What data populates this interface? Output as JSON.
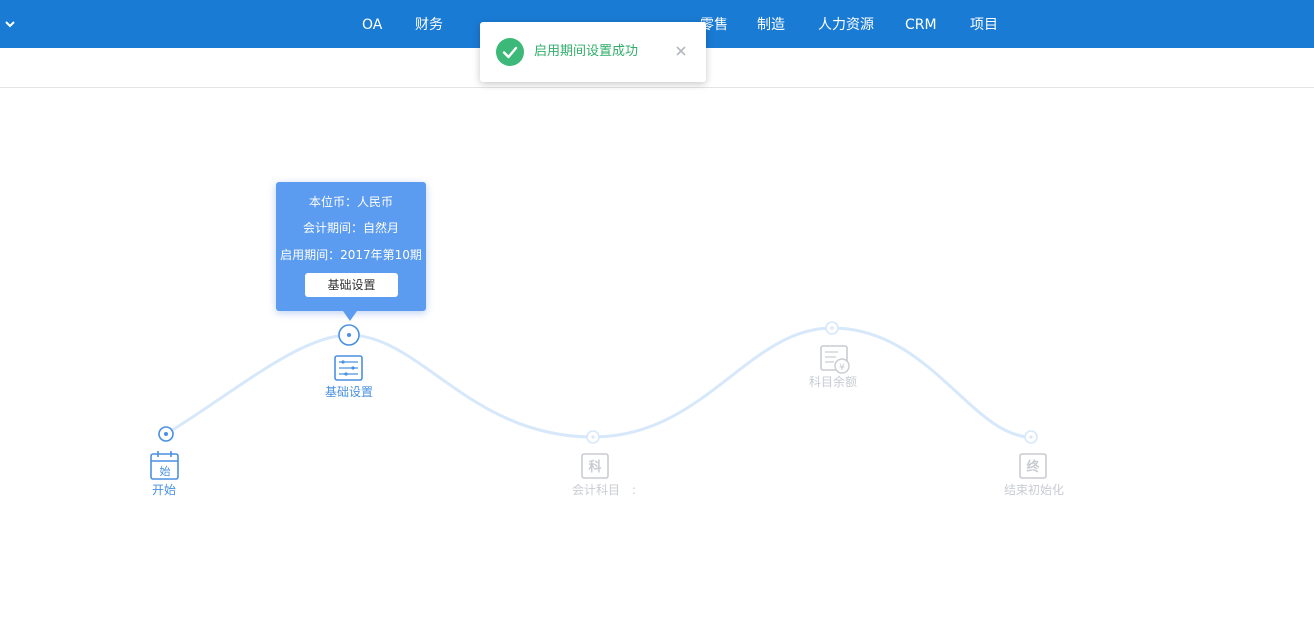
{
  "top_nav": {
    "items": [
      {
        "label": "OA"
      },
      {
        "label": "财务"
      },
      {
        "label": "零售"
      },
      {
        "label": "制造"
      },
      {
        "label": "人力资源"
      },
      {
        "label": "CRM"
      },
      {
        "label": "项目"
      }
    ]
  },
  "toast": {
    "message": "启用期间设置成功",
    "status_color": "#2fae6a"
  },
  "popover": {
    "currency_line": "本位币：人民币",
    "period_line": "会计期间：自然月",
    "start_period_line": "启用期间：2017年第10期",
    "button_label": "基础设置"
  },
  "steps": [
    {
      "label": "开始",
      "icon_glyph": "始",
      "state": "done"
    },
    {
      "label": "基础设置",
      "state": "current"
    },
    {
      "label": "会计科目",
      "icon_glyph": "科",
      "state": "pending"
    },
    {
      "label": "科目余额",
      "state": "pending"
    },
    {
      "label": "结束初始化",
      "icon_glyph": "终",
      "state": "pending"
    }
  ],
  "stray_text": ":",
  "colors": {
    "topbar": "#1a7bd4",
    "active": "#4a90e2",
    "popover": "#5b9bf0",
    "dim": "#c8ccd2",
    "curve": "#d6e8fa"
  }
}
